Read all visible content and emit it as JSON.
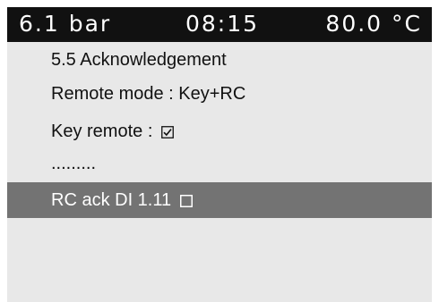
{
  "status_bar": {
    "pressure": "6.1 bar",
    "time": "08:15",
    "temperature": "80.0 °C"
  },
  "menu": {
    "title": "5.5 Acknowledgement",
    "remote_mode": "Remote mode : Key+RC",
    "key_remote_label": "Key remote :",
    "key_remote_checked": true,
    "more": ".........",
    "rc_ack_label": "RC ack DI 1.11",
    "rc_ack_checked": false
  },
  "colors": {
    "status_bar_bg": "#111111",
    "screen_bg": "#e8e8e8",
    "selected_row_bg": "#737373"
  }
}
